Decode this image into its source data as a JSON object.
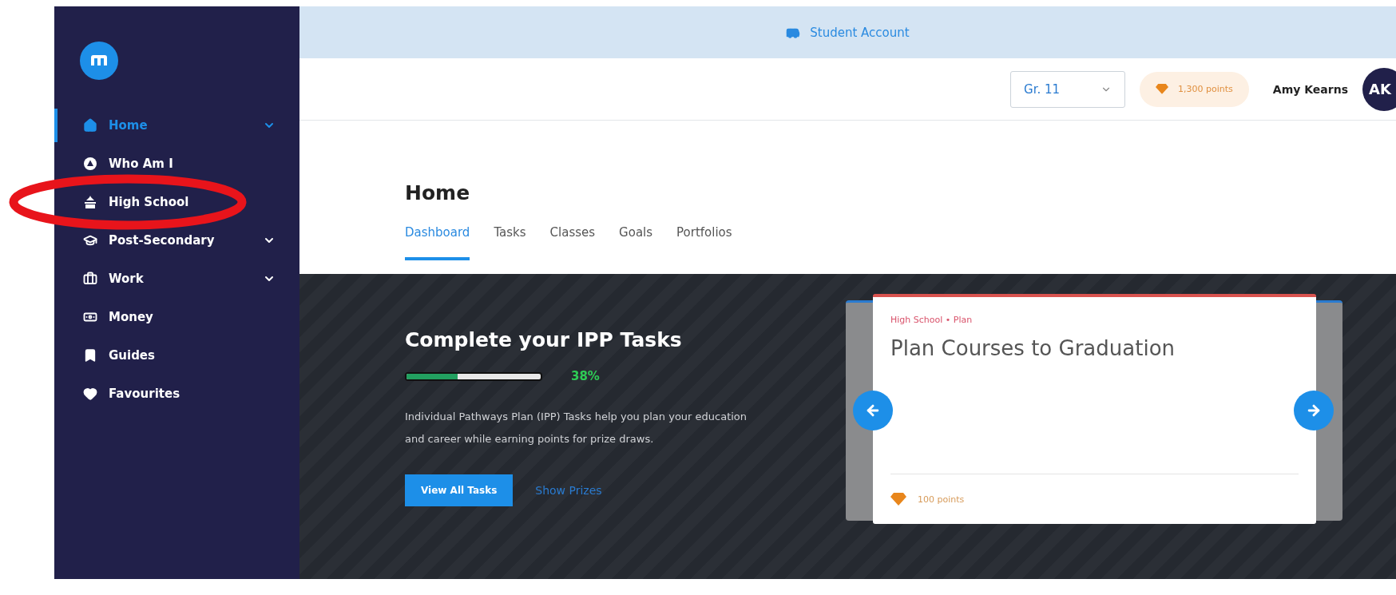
{
  "sidebar": {
    "items": [
      {
        "label": "Home",
        "selected": true,
        "expandable": true,
        "circled": false
      },
      {
        "label": "Who Am I",
        "selected": false,
        "expandable": false,
        "circled": false
      },
      {
        "label": "High School",
        "selected": false,
        "expandable": false,
        "circled": true
      },
      {
        "label": "Post-Secondary",
        "selected": false,
        "expandable": true,
        "circled": false
      },
      {
        "label": "Work",
        "selected": false,
        "expandable": true,
        "circled": false
      },
      {
        "label": "Money",
        "selected": false,
        "expandable": false,
        "circled": false
      },
      {
        "label": "Guides",
        "selected": false,
        "expandable": false,
        "circled": false
      },
      {
        "label": "Favourites",
        "selected": false,
        "expandable": false,
        "circled": false
      }
    ]
  },
  "banner": {
    "text": "Student Account"
  },
  "header": {
    "grade": "Gr. 11",
    "points": "1,300 points",
    "user_name": "Amy Kearns",
    "avatar": "AK"
  },
  "page": {
    "title": "Home",
    "tabs": [
      {
        "label": "Dashboard",
        "selected": true
      },
      {
        "label": "Tasks",
        "selected": false
      },
      {
        "label": "Classes",
        "selected": false
      },
      {
        "label": "Goals",
        "selected": false
      },
      {
        "label": "Portfolios",
        "selected": false
      }
    ]
  },
  "hero": {
    "title": "Complete your IPP Tasks",
    "progress": {
      "level": 0.38,
      "reading": "38%"
    },
    "description": "Individual Pathways Plan (IPP) Tasks help you plan your education and career while earning points for prize draws.",
    "primary_button": "View All Tasks",
    "link": "Show Prizes",
    "card": {
      "category": "High School • Plan",
      "title": "Plan Courses to Graduation",
      "points": "100 points"
    }
  }
}
